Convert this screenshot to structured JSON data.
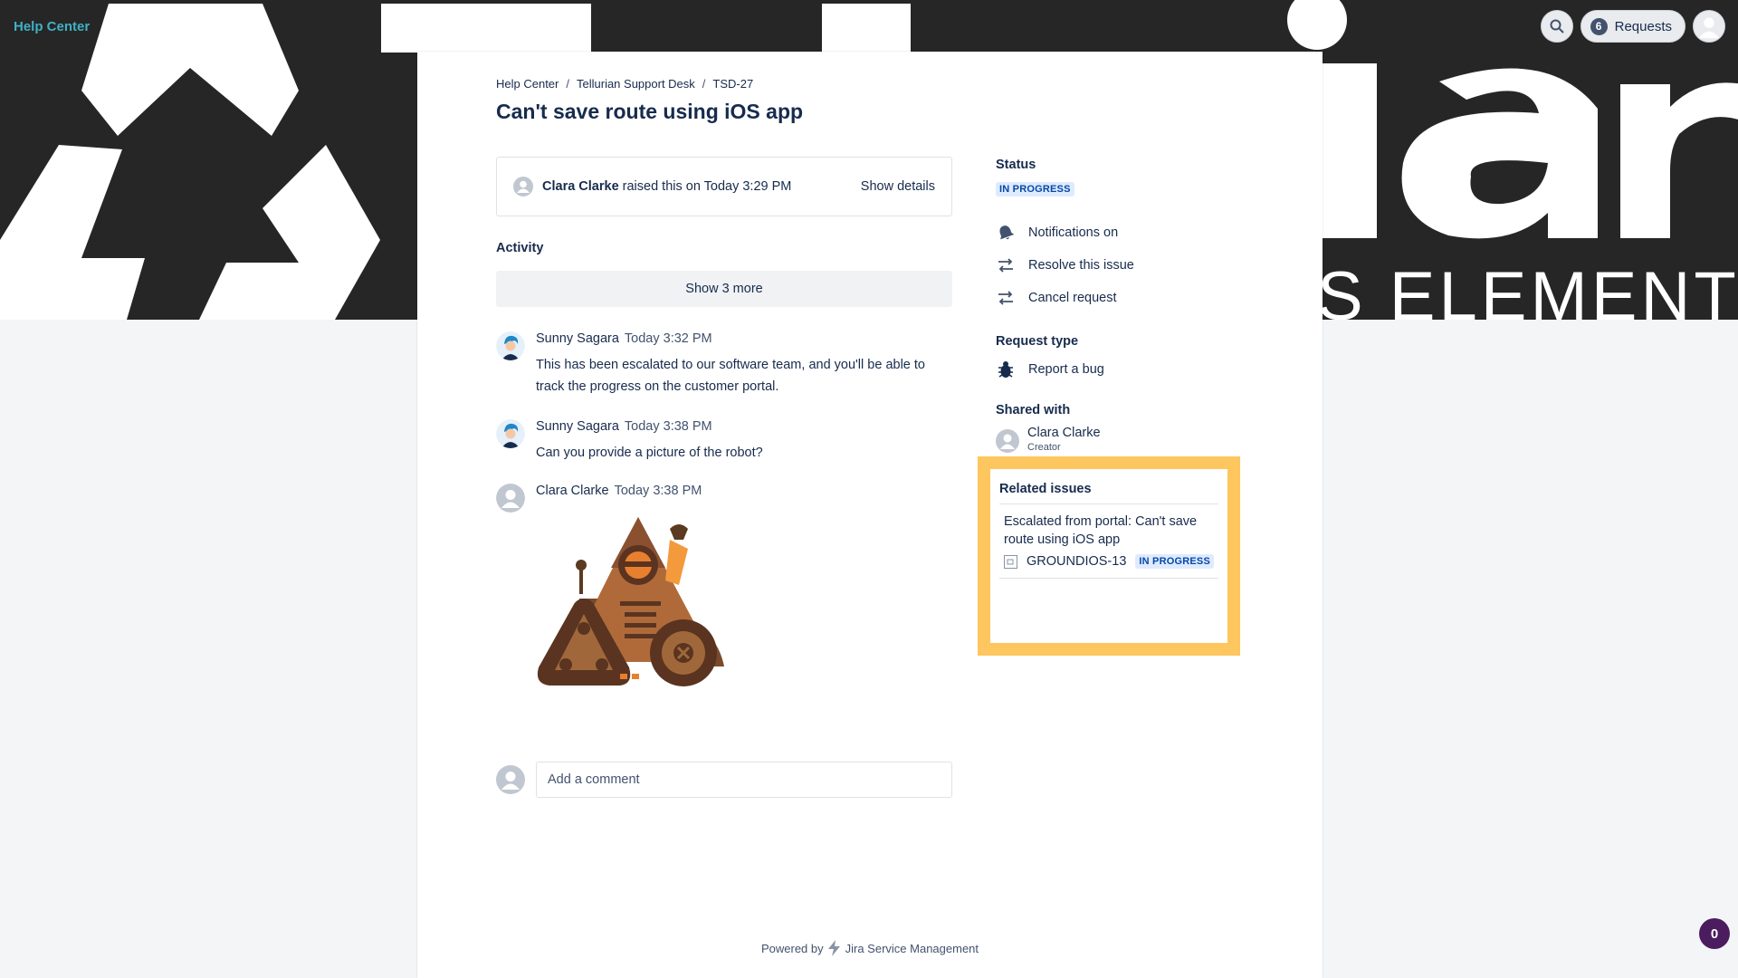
{
  "header": {
    "help_center": "Help Center",
    "requests_count": "6",
    "requests_label": "Requests"
  },
  "breadcrumb": [
    "Help Center",
    "Tellurian Support Desk",
    "TSD-27"
  ],
  "breadcrumb_separator": "/",
  "request": {
    "title": "Can't save route using iOS app",
    "raised_by": "Clara Clarke",
    "raised_text": "raised this on Today 3:29 PM",
    "show_details": "Show details"
  },
  "activity": {
    "label": "Activity",
    "show_more": "Show 3 more",
    "comments": [
      {
        "author": "Sunny Sagara",
        "time": "Today 3:32 PM",
        "body": "This has been escalated to our software team, and you'll be able to track the progress on the customer portal."
      },
      {
        "author": "Sunny Sagara",
        "time": "Today 3:38 PM",
        "body": "Can you provide a picture of the robot?"
      },
      {
        "author": "Clara Clarke",
        "time": "Today 3:38 PM",
        "body": ""
      }
    ],
    "comment_placeholder": "Add a comment"
  },
  "sidebar": {
    "status_label": "Status",
    "status_value": "IN PROGRESS",
    "actions": [
      {
        "label": "Notifications on",
        "icon": "bell-icon"
      },
      {
        "label": "Resolve this issue",
        "icon": "transition-icon"
      },
      {
        "label": "Cancel request",
        "icon": "transition-icon"
      }
    ],
    "request_type_label": "Request type",
    "request_type_value": "Report a bug",
    "shared_with_label": "Shared with",
    "shared_name": "Clara Clarke",
    "shared_role": "Creator"
  },
  "related": {
    "label": "Related issues",
    "title": "Escalated from portal: Can't save route using iOS app",
    "key": "GROUNDIOS-13",
    "status": "IN PROGRESS"
  },
  "footer": {
    "powered_by": "Powered by",
    "product": "Jira Service Management"
  },
  "notification_count": "0",
  "colors": {
    "banner": "#262626",
    "accent_link": "#3fb1c4",
    "lozenge_bg": "#deebff",
    "lozenge_text": "#0747a6",
    "highlight": "#fdc65e"
  }
}
